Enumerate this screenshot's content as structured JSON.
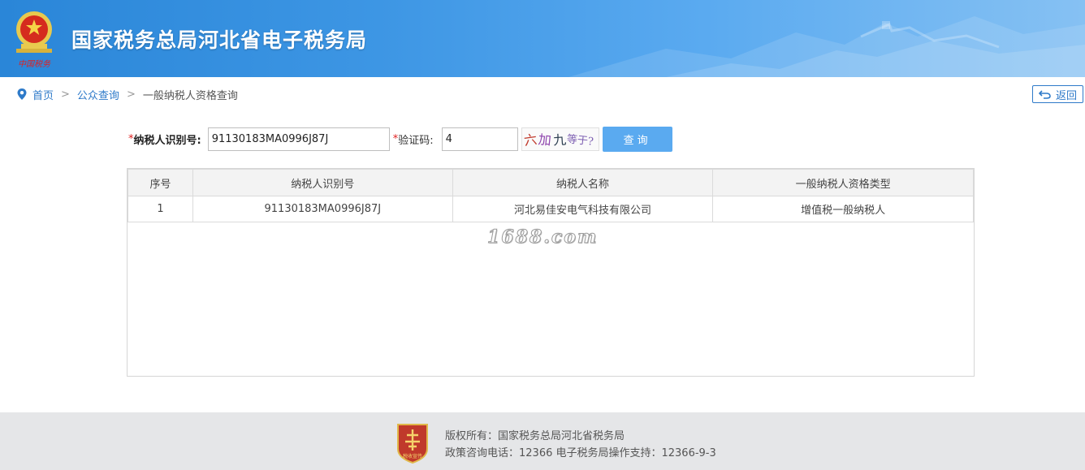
{
  "header": {
    "site_title": "国家税务总局河北省电子税务局",
    "logo_caption": "中国税务",
    "brand_color": "#3d96e4"
  },
  "breadcrumb": {
    "home": "首页",
    "sep1": ">",
    "public_query": "公众查询",
    "sep2": ">",
    "current": "一般纳税人资格查询"
  },
  "back_button": {
    "label": "返回"
  },
  "form": {
    "taxid_required_mark": "*",
    "taxid_label": "纳税人识别号:",
    "taxid_value": "91130183MA0996J87J",
    "code_required_mark": "*",
    "code_label": "验证码:",
    "code_value": "4",
    "captcha_chars": [
      "六",
      "加",
      "九",
      "等于?"
    ],
    "query_label": "查询"
  },
  "table": {
    "columns": [
      "序号",
      "纳税人识别号",
      "纳税人名称",
      "一般纳税人资格类型"
    ],
    "rows": [
      [
        "1",
        "91130183MA0996J87J",
        "河北易佳安电气科技有限公司",
        "增值税一般纳税人"
      ]
    ]
  },
  "watermark": "1688.com",
  "footer": {
    "badge_text": "税收宣传",
    "copyright": "版权所有：国家税务总局河北省税务局",
    "contact": "政策咨询电话：12366  电子税务局操作支持：12366-9-3"
  }
}
